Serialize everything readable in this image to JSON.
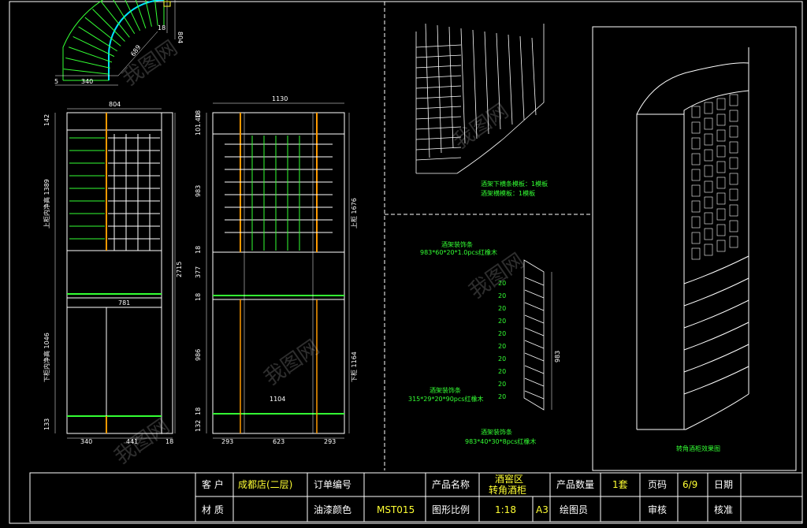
{
  "title_block": {
    "customer_label": "客 户",
    "customer_value": "成都店(二层)",
    "order_label": "订单编号",
    "product_name_label": "产品名称",
    "product_name_line1": "酒窖区",
    "product_name_line2": "转角酒柜",
    "quantity_label": "产品数量",
    "quantity_value": "1套",
    "page_label": "页码",
    "page_value": "6/9",
    "date_label": "日期",
    "material_label": "材 质",
    "paint_label": "油漆颜色",
    "paint_value": "MST015",
    "scale_label": "图形比例",
    "scale_value": "1:18",
    "paper_value": "A3",
    "drafter_label": "绘图员",
    "review_label": "审核",
    "approve_label": "核准"
  },
  "front_view_left": {
    "width_top": "804",
    "dim_top_block": "142",
    "dim_upper_label": "上柜内净高 1389",
    "dim_total": "2715",
    "dim_inner_width": "781",
    "dim_lower_label": "下柜内净高 1046",
    "dim_base": "133",
    "bottom_dims": [
      "340",
      "441",
      "18"
    ]
  },
  "front_view_right": {
    "width_top": "1130",
    "left_dims": [
      "18",
      "101.40",
      "983",
      "18",
      "377",
      "18",
      "986",
      "18",
      "132"
    ],
    "dim_upper_label": "上柜 1676",
    "dim_lower_label": "下柜 1164",
    "dim_inner_width": "1104",
    "bottom_dims": [
      "293",
      "623",
      "293"
    ]
  },
  "plan_view": {
    "dims": [
      "340",
      "5",
      "18",
      "804",
      "689"
    ]
  },
  "notes": {
    "perspective_note_1": "酒架下横条模板：1模板",
    "perspective_note_2": "酒架横模板：1模板",
    "detail_top_title": "酒架装饰条",
    "detail_top_spec": "983*60*20*1.0pcs红橡木",
    "detail_mid_title": "酒架装饰条",
    "detail_mid_spec": "315*29*20*90pcs红橡木",
    "detail_bot_title": "酒架装饰条",
    "detail_bot_spec": "983*40*30*8pcs红橡木",
    "detail_height": "983",
    "detail_rung_labels": [
      "20",
      "20",
      "20",
      "20",
      "20",
      "20",
      "20",
      "20",
      "20",
      "20"
    ],
    "render_caption": "转角酒柜效果图"
  },
  "watermark": "我图网",
  "colors": {
    "line": "#ffffff",
    "green": "#33ff33",
    "yellow": "#ffff33",
    "orange": "#ff9900",
    "cyan": "#00e5ff"
  }
}
